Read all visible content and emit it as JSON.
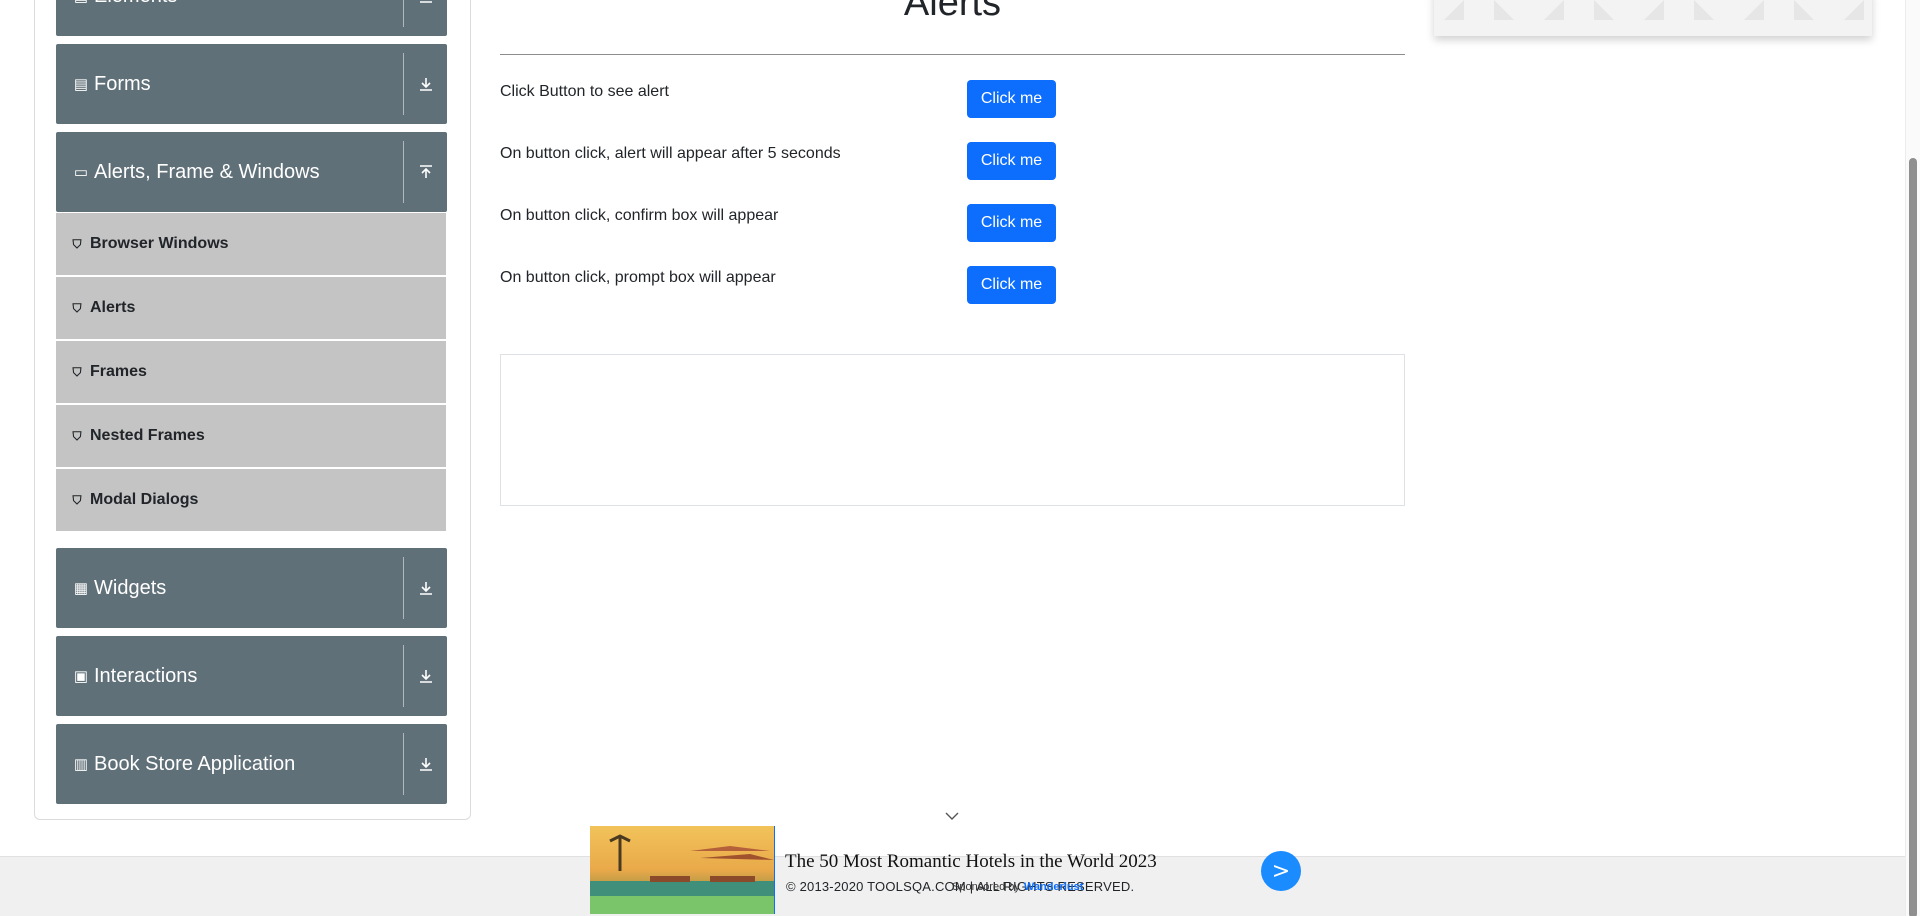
{
  "sidebar": {
    "groups": [
      {
        "label": "Elements",
        "icon": "elements-icon",
        "arrow": "download-icon"
      },
      {
        "label": "Forms",
        "icon": "forms-icon",
        "arrow": "download-icon"
      },
      {
        "label": "Alerts, Frame & Windows",
        "icon": "window-icon",
        "arrow": "upload-icon"
      },
      {
        "label": "Widgets",
        "icon": "widgets-icon",
        "arrow": "download-icon"
      },
      {
        "label": "Interactions",
        "icon": "interactions-icon",
        "arrow": "download-icon"
      },
      {
        "label": "Book Store Application",
        "icon": "bookstore-icon",
        "arrow": "download-icon"
      }
    ],
    "sub_items": [
      {
        "label": "Browser Windows"
      },
      {
        "label": "Alerts"
      },
      {
        "label": "Frames"
      },
      {
        "label": "Nested Frames"
      },
      {
        "label": "Modal Dialogs"
      }
    ]
  },
  "main": {
    "title": "Alerts",
    "rows": [
      {
        "text": "Click Button to see alert",
        "button": "Click me"
      },
      {
        "text": "On button click, alert will appear after 5 seconds",
        "button": "Click me"
      },
      {
        "text": "On button click, confirm box will appear",
        "button": "Click me"
      },
      {
        "text": "On button click, prompt box will appear",
        "button": "Click me"
      }
    ]
  },
  "footer": {
    "copyright": "© 2013-2020 TOOLSQA.COM | ALL RIGHTS RESERVED."
  },
  "ad": {
    "title": "The 50 Most Romantic Hotels in the World 2023",
    "sponsor_label": "Sponsored by",
    "sponsor_brand": "Wanderlust",
    "go_label": ">"
  },
  "colors": {
    "sidebar_header": "#607078",
    "sub_item": "#c4c4c4",
    "button": "#0d6efd"
  }
}
